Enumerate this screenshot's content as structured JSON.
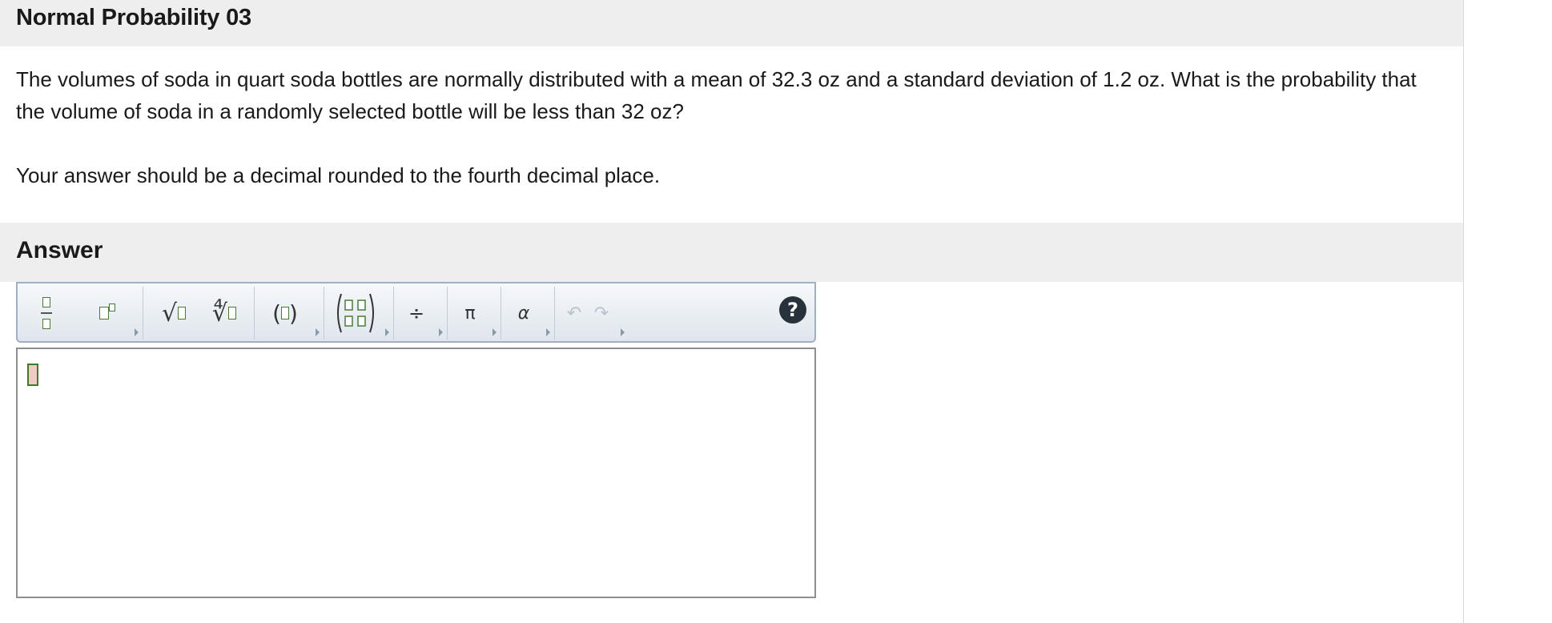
{
  "header": {
    "title": "Normal Probability 03"
  },
  "question": {
    "text": "The volumes of soda in quart soda bottles are normally distributed with a mean of 32.3 oz and a standard deviation of 1.2 oz. What is the probability that the volume of soda in a randomly selected bottle will be less than 32 oz?",
    "instruction": "Your answer should be a decimal rounded to the fourth decimal place."
  },
  "answer": {
    "heading": "Answer",
    "toolbar": {
      "sqrt_symbol": "√",
      "nth_root_symbol": "∜",
      "paren_open": "(",
      "paren_close": ")",
      "divide_symbol": "÷",
      "pi_symbol": "π",
      "alpha_symbol": "α",
      "undo_symbol": "↶",
      "redo_symbol": "↷",
      "help_symbol": "?"
    },
    "value": ""
  },
  "colors": {
    "header_bg": "#eeeeee",
    "toolbar_border": "#9fb0c4",
    "placeholder_green": "#4a7a3a",
    "help_bg": "#27323d"
  }
}
